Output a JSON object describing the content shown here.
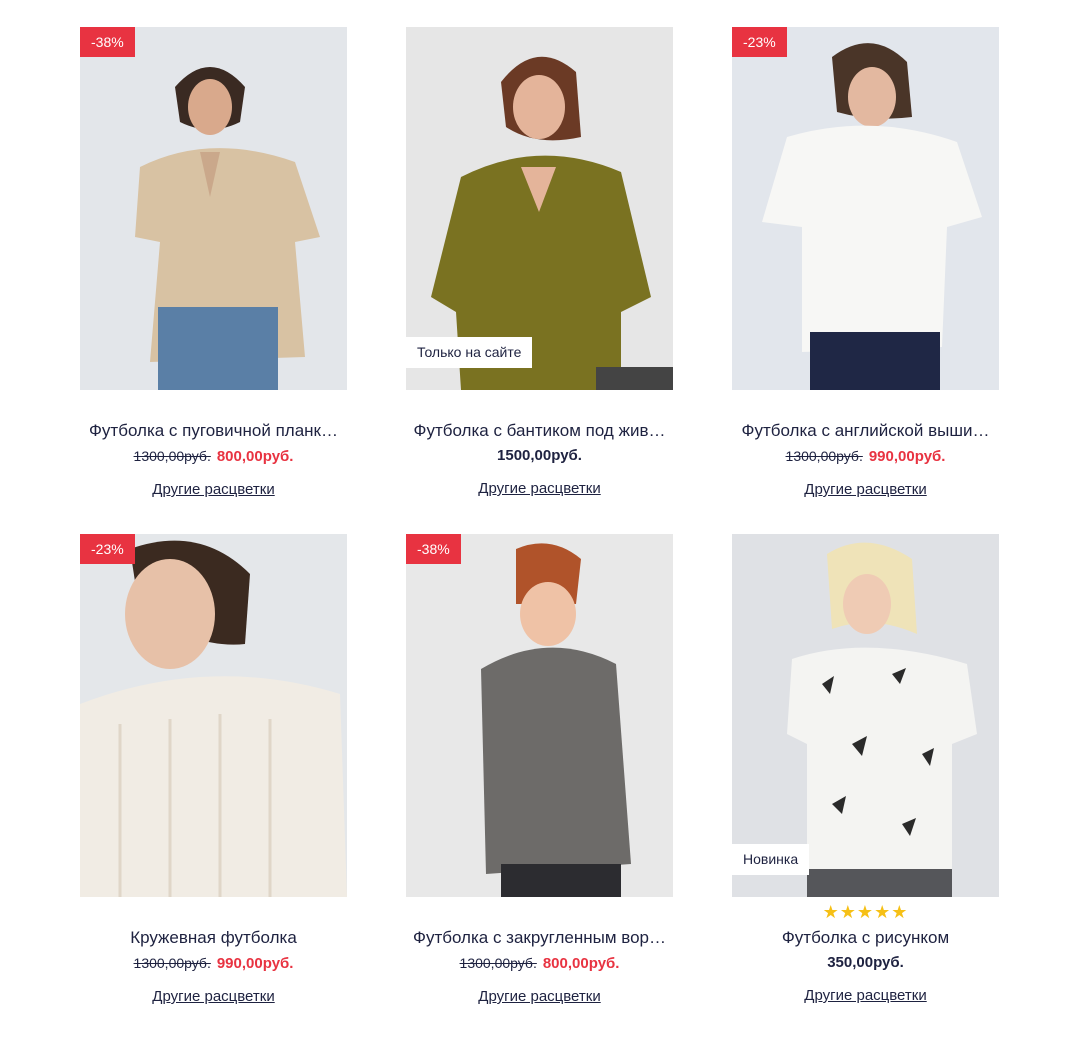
{
  "products": [
    {
      "discount": "-38%",
      "tag": "",
      "rating": "",
      "name": "Футболка с пуговичной планк…",
      "old_price": "1300,00руб.",
      "price": "800,00руб.",
      "colors": "Другие расцветки"
    },
    {
      "discount": "",
      "tag": "Только на сайте",
      "rating": "",
      "name": "Футболка с бантиком под жив…",
      "old_price": "",
      "price": "1500,00руб.",
      "colors": "Другие расцветки"
    },
    {
      "discount": "-23%",
      "tag": "",
      "rating": "",
      "name": "Футболка с английской выши…",
      "old_price": "1300,00руб.",
      "price": "990,00руб.",
      "colors": "Другие расцветки"
    },
    {
      "discount": "-23%",
      "tag": "",
      "rating": "",
      "name": "Кружевная футболка",
      "old_price": "1300,00руб.",
      "price": "990,00руб.",
      "colors": "Другие расцветки"
    },
    {
      "discount": "-38%",
      "tag": "",
      "rating": "",
      "name": "Футболка с закругленным вор…",
      "old_price": "1300,00руб.",
      "price": "800,00руб.",
      "colors": "Другие расцветки"
    },
    {
      "discount": "",
      "tag": "Новинка",
      "rating": "★★★★★",
      "name": "Футболка с рисунком",
      "old_price": "",
      "price": "350,00руб.",
      "colors": "Другие расцветки"
    }
  ],
  "colors": {
    "accent": "#e83341",
    "text": "#1e2240",
    "star": "#f6c016"
  }
}
